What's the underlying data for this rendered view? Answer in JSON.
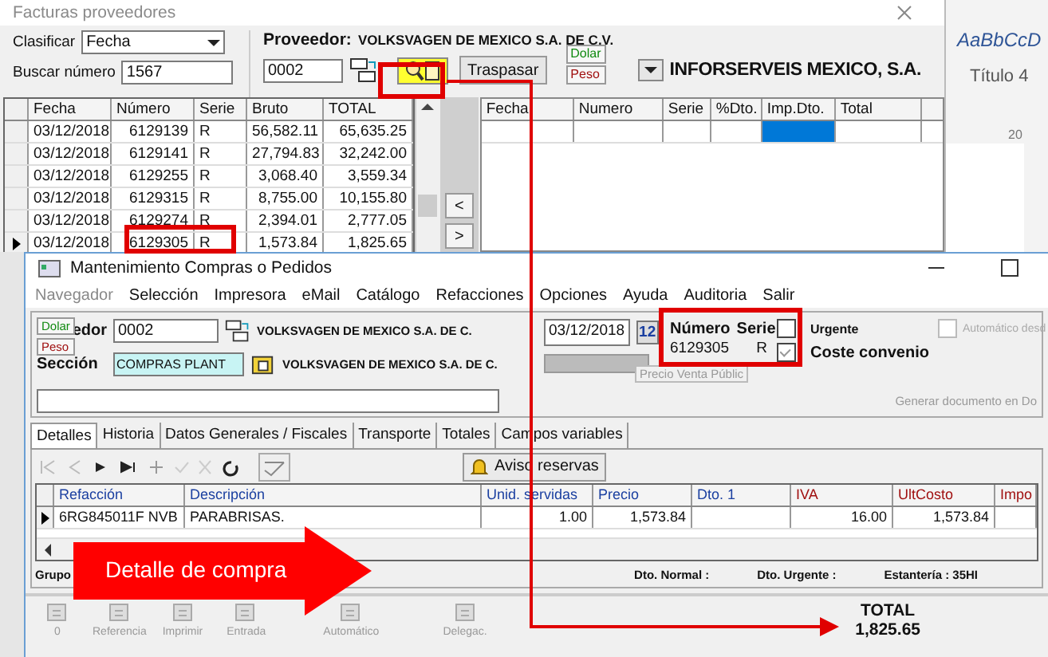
{
  "document_background": {
    "style_sample": "AaBbCcD",
    "style_name": "Título 4",
    "ruler_mark": "20"
  },
  "invoices_window": {
    "title": "Facturas proveedores",
    "sort_label": "Clasificar",
    "sort_value": "Fecha",
    "search_label": "Buscar número",
    "search_value": "1567",
    "supplier_label": "Proveedor:",
    "supplier_name": "VOLKSVAGEN DE MEXICO S.A. DE C.V.",
    "supplier_code": "0002",
    "transfer_button": "Traspasar",
    "currencies": [
      {
        "label": "Dolar",
        "color": "#108a10"
      },
      {
        "label": "Peso",
        "color": "#a01010"
      }
    ],
    "company": "INFORSERVEIS MEXICO, S.A.",
    "columns": [
      "Fecha",
      "Número",
      "Serie",
      "Bruto",
      "TOTAL"
    ],
    "rows": [
      {
        "cells": [
          "03/12/2018",
          "6129139",
          "R",
          "56,582.11",
          "65,635.25"
        ],
        "selected": false
      },
      {
        "cells": [
          "03/12/2018",
          "6129141",
          "R",
          "27,794.83",
          "32,242.00"
        ],
        "selected": false
      },
      {
        "cells": [
          "03/12/2018",
          "6129255",
          "R",
          "3,068.40",
          "3,559.34"
        ],
        "selected": false
      },
      {
        "cells": [
          "03/12/2018",
          "6129315",
          "R",
          "8,755.00",
          "10,155.80"
        ],
        "selected": false
      },
      {
        "cells": [
          "03/12/2018",
          "6129274",
          "R",
          "2,394.01",
          "2,777.05"
        ],
        "selected": false
      },
      {
        "cells": [
          "03/12/2018",
          "6129305",
          "R",
          "1,573.84",
          "1,825.65"
        ],
        "selected": true
      }
    ],
    "prev_button": "<",
    "next_button": ">",
    "detail_columns": [
      "Fecha",
      "Numero",
      "Serie",
      "%Dto.",
      "Imp.Dto.",
      "Total"
    ]
  },
  "order_window": {
    "title": "Mantenimiento Compras o Pedidos",
    "menu": [
      {
        "label": "Navegador",
        "disabled": true
      },
      {
        "label": "Selección",
        "disabled": false
      },
      {
        "label": "Impresora",
        "disabled": false
      },
      {
        "label": "eMail",
        "disabled": false
      },
      {
        "label": "Catálogo",
        "disabled": false
      },
      {
        "label": "Refacciones",
        "disabled": false
      },
      {
        "label": "Opciones",
        "disabled": false
      },
      {
        "label": "Ayuda",
        "disabled": false
      },
      {
        "label": "Auditoria",
        "disabled": false
      },
      {
        "label": "Salir",
        "disabled": false
      }
    ],
    "currencies": [
      {
        "label": "Dolar",
        "color": "#108a10"
      },
      {
        "label": "Peso",
        "color": "#a01010"
      }
    ],
    "supplier_label": "edor",
    "supplier_code": "0002",
    "supplier_name": "VOLKSVAGEN DE MEXICO S.A. DE C.",
    "section_label": "Sección",
    "section_value": "COMPRAS PLANT",
    "section_name": "VOLKSVAGEN DE MEXICO S.A. DE C.",
    "date": "03/12/2018",
    "calendar": "12",
    "number_label": "Número",
    "number": "6129305",
    "serie_label": "Serie",
    "serie": "R",
    "checks": [
      {
        "label": "Urgente",
        "checked": false,
        "disabled": false
      },
      {
        "label": "Coste convenio",
        "checked": true,
        "disabled": false
      },
      {
        "label": "Automático desd",
        "checked": false,
        "disabled": true
      }
    ],
    "price_list": "Precio Venta Públic",
    "generate_note": "Generar documento en Do",
    "tabs": [
      {
        "label": "Detalles",
        "selected": true
      },
      {
        "label": "Historia",
        "selected": false
      },
      {
        "label": "Datos Generales / Fiscales",
        "selected": false
      },
      {
        "label": "Transporte",
        "selected": false
      },
      {
        "label": "Totales",
        "selected": false
      },
      {
        "label": "Campos variables",
        "selected": false
      }
    ],
    "reservations_button": "Aviso reservas",
    "columns": [
      {
        "label": "Refacción",
        "color": "#1a3fa0"
      },
      {
        "label": "Descripción",
        "color": "#1a3fa0"
      },
      {
        "label": "Unid. servidas",
        "color": "#1a3fa0"
      },
      {
        "label": "Precio",
        "color": "#1a3fa0"
      },
      {
        "label": "Dto. 1",
        "color": "#1a3fa0"
      },
      {
        "label": "IVA",
        "color": "#a01010"
      },
      {
        "label": "UltCosto",
        "color": "#a01010"
      },
      {
        "label": "Impo",
        "color": "#a01010"
      }
    ],
    "rows": [
      {
        "part": "6RG845011F NVB",
        "description": "PARABRISAS.",
        "quantity": "1.00",
        "price": "1,573.84",
        "vat": "16.00",
        "last_cost": "1,573.84",
        "selected": true
      }
    ],
    "footer": {
      "group_label": "Grupo",
      "normal_discount": "Dto. Normal :",
      "urgent_discount": "Dto. Urgente :",
      "shelf": "Estantería : 35HI"
    },
    "actions": [
      "0",
      "Referencia",
      "Imprimir",
      "Entrada",
      "Automático",
      "Delegac."
    ],
    "total_label": "TOTAL",
    "total": "1,825.65"
  },
  "annotation": {
    "callout": "Detalle de compra"
  }
}
